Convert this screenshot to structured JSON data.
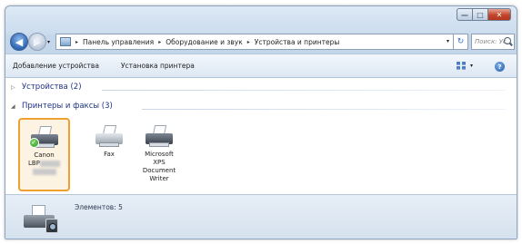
{
  "window": {
    "caption": {
      "minimize": "—",
      "maximize": "□",
      "close": "✕"
    }
  },
  "nav": {
    "back_glyph": "◀",
    "forward_glyph": "▶",
    "dropdown_glyph": "▾"
  },
  "address": {
    "crumbs": [
      "Панель управления",
      "Оборудование и звук",
      "Устройства и принтеры"
    ],
    "separator": "▸",
    "dropdown_glyph": "▾",
    "refresh_glyph": "↻"
  },
  "search": {
    "placeholder": "Поиск: Ус..."
  },
  "toolbar": {
    "add_device": "Добавление устройства",
    "add_printer": "Установка принтера",
    "view_dropdown": "▾",
    "help": "?"
  },
  "groups": {
    "devices": {
      "label": "Устройства (2)",
      "expanded": false,
      "glyph": "▷"
    },
    "printers": {
      "label": "Принтеры и факсы (3)",
      "expanded": true,
      "glyph": "◢"
    }
  },
  "printers": [
    {
      "label_line1": "Canon",
      "label_line2": "LBP",
      "selected": true,
      "default": true,
      "check": "✓"
    },
    {
      "label_line1": "Fax",
      "selected": false
    },
    {
      "label_line1": "Microsoft",
      "label_line2": "XPS",
      "label_line3": "Document",
      "label_line4": "Writer",
      "selected": false
    }
  ],
  "details": {
    "count_text": "Элементов: 5"
  },
  "colors": {
    "selection_border": "#f0a030",
    "group_header": "#1e3287",
    "window_frame": "#c4d6ea"
  }
}
